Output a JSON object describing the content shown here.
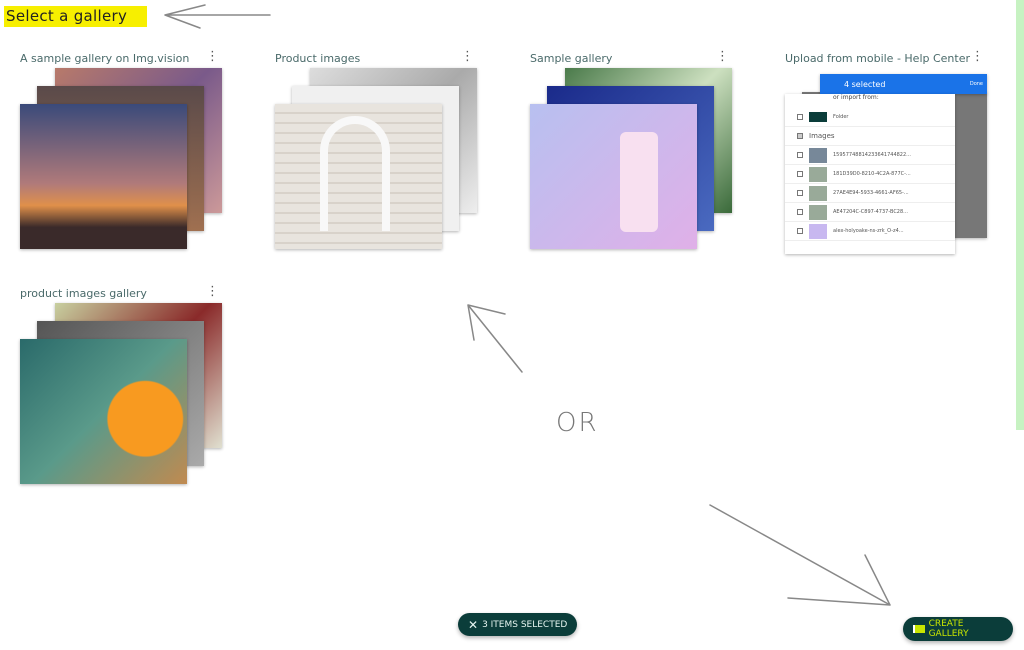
{
  "page": {
    "title": "Select a gallery",
    "annotation_or": "OR"
  },
  "galleries": [
    {
      "title": "A sample gallery on Img.vision"
    },
    {
      "title": "Product images"
    },
    {
      "title": "Sample gallery"
    },
    {
      "title": "Upload from mobile - Help Center"
    },
    {
      "title": "product images gallery"
    }
  ],
  "phone": {
    "header": "4 selected",
    "done": "Done",
    "import": "or import from:",
    "folder": "Folder",
    "images": "Images",
    "files": [
      "15957748814233641744822...",
      "181D39D0-8210-4C2A-877C-...",
      "27AE4E94-5933-4661-AF65-...",
      "AE47204C-C897-4737-BC28...",
      "alex-holyoake-ns-zrk_O-z4..."
    ]
  },
  "footer": {
    "selected_label": "3 ITEMS SELECTED",
    "create_label": "CREATE GALLERY"
  },
  "colors": {
    "accent": "#0b3d3a",
    "highlight": "#f7ef00",
    "create_text": "#c8e600"
  }
}
